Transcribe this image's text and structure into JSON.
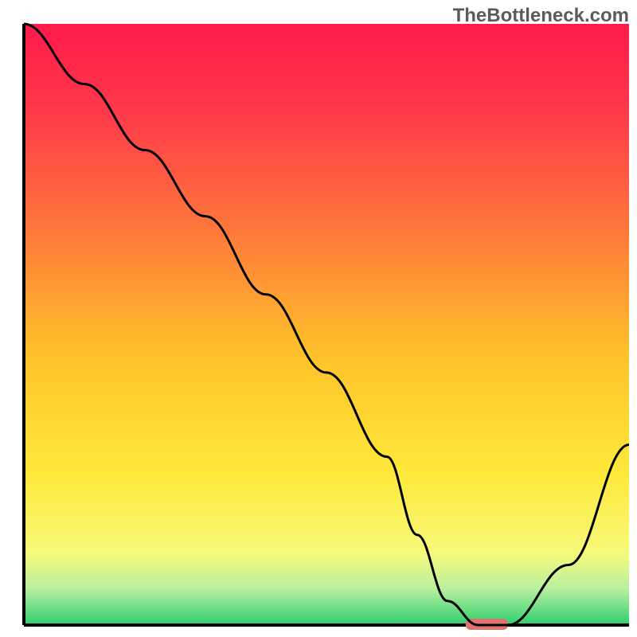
{
  "watermark": "TheBottleneck.com",
  "chart_data": {
    "type": "line",
    "title": "",
    "xlabel": "",
    "ylabel": "",
    "xlim": [
      0,
      100
    ],
    "ylim": [
      0,
      100
    ],
    "x": [
      0,
      10,
      20,
      30,
      40,
      50,
      60,
      65,
      70,
      75,
      80,
      90,
      100
    ],
    "values": [
      100,
      90,
      79,
      68,
      55,
      42,
      28,
      15,
      4,
      0,
      0,
      10,
      30
    ],
    "marker": {
      "x_start": 73,
      "x_end": 80,
      "y": 0
    },
    "background": {
      "type": "vertical-gradient",
      "stops": [
        {
          "pos": 0.0,
          "color": "#ff1a4b"
        },
        {
          "pos": 0.15,
          "color": "#ff3a4a"
        },
        {
          "pos": 0.35,
          "color": "#ff7a3a"
        },
        {
          "pos": 0.55,
          "color": "#ffc22a"
        },
        {
          "pos": 0.75,
          "color": "#ffe93a"
        },
        {
          "pos": 0.88,
          "color": "#f6f97a"
        },
        {
          "pos": 0.94,
          "color": "#b8f0a0"
        },
        {
          "pos": 1.0,
          "color": "#2ecf6f"
        }
      ]
    },
    "line_color": "#000000",
    "marker_color": "#e0736f",
    "axis_color": "#000000"
  }
}
